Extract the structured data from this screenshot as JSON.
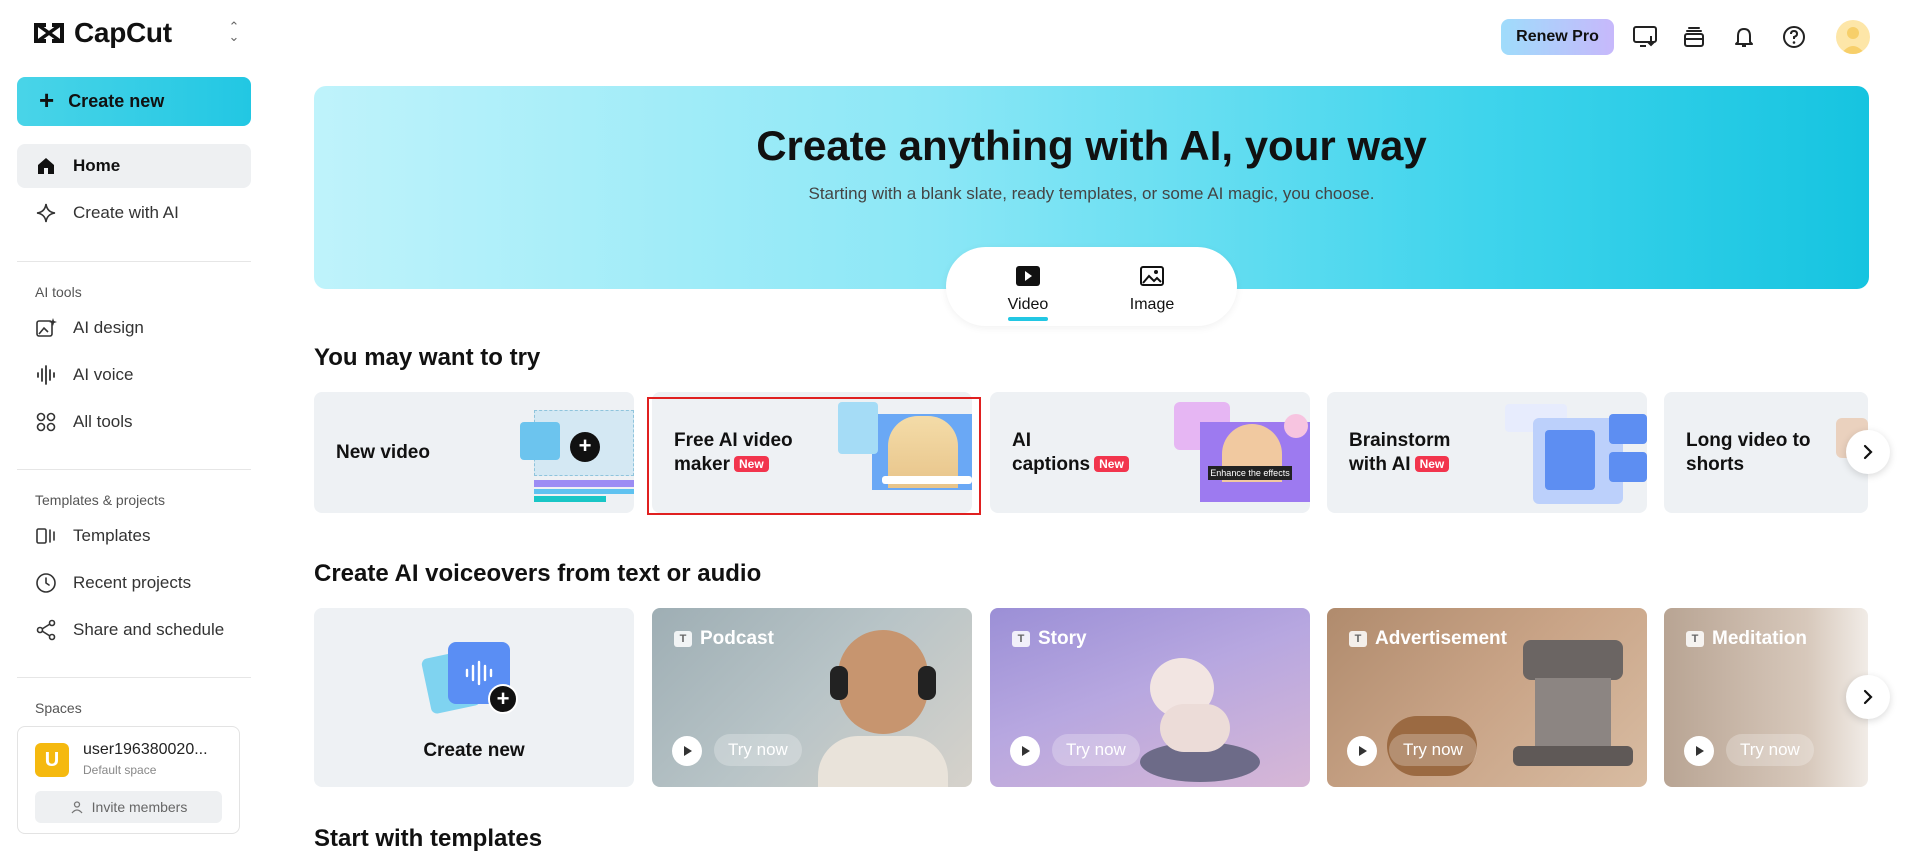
{
  "app": {
    "name": "CapCut"
  },
  "sidebar": {
    "create_label": "Create new",
    "nav": [
      {
        "label": "Home",
        "icon": "home-icon"
      },
      {
        "label": "Create with AI",
        "icon": "sparkle-icon"
      }
    ],
    "ai_tools_title": "AI tools",
    "ai_tools": [
      {
        "label": "AI design",
        "icon": "image-sparkle-icon"
      },
      {
        "label": "AI voice",
        "icon": "waveform-icon"
      },
      {
        "label": "All tools",
        "icon": "grid-icon"
      }
    ],
    "templates_title": "Templates & projects",
    "templates": [
      {
        "label": "Templates",
        "icon": "template-icon"
      },
      {
        "label": "Recent projects",
        "icon": "clock-icon"
      },
      {
        "label": "Share and schedule",
        "icon": "share-icon"
      }
    ],
    "spaces_title": "Spaces",
    "space": {
      "avatar_letter": "U",
      "name": "user196380020...",
      "sub": "Default space",
      "invite_label": "Invite members"
    }
  },
  "topbar": {
    "renew_label": "Renew Pro"
  },
  "hero": {
    "title": "Create anything with AI, your way",
    "subtitle": "Starting with a blank slate, ready templates, or some AI magic, you choose.",
    "modes": [
      {
        "label": "Video",
        "selected": true
      },
      {
        "label": "Image",
        "selected": false
      }
    ]
  },
  "try_section": {
    "title": "You may want to try",
    "badge_label": "New",
    "cards": [
      {
        "line1": "New video",
        "line2": "",
        "badge": false
      },
      {
        "line1": "Free AI video",
        "line2": "maker",
        "badge": true
      },
      {
        "line1": "AI",
        "line2": "captions",
        "badge": true
      },
      {
        "line1": "Brainstorm",
        "line2": "with AI",
        "badge": true
      },
      {
        "line1": "Long video to",
        "line2": "shorts",
        "badge": false
      }
    ],
    "caption_overlay": "Enhance the effects"
  },
  "voiceover_section": {
    "title": "Create AI voiceovers from text or audio",
    "create_label": "Create new",
    "try_label": "Try now",
    "cards": [
      {
        "label": "Podcast"
      },
      {
        "label": "Story"
      },
      {
        "label": "Advertisement"
      },
      {
        "label": "Meditation"
      }
    ]
  },
  "templates_section": {
    "title": "Start with templates"
  },
  "colors": {
    "accent": "#22c7e3",
    "badge": "#f2354d",
    "highlight": "#e02020"
  }
}
